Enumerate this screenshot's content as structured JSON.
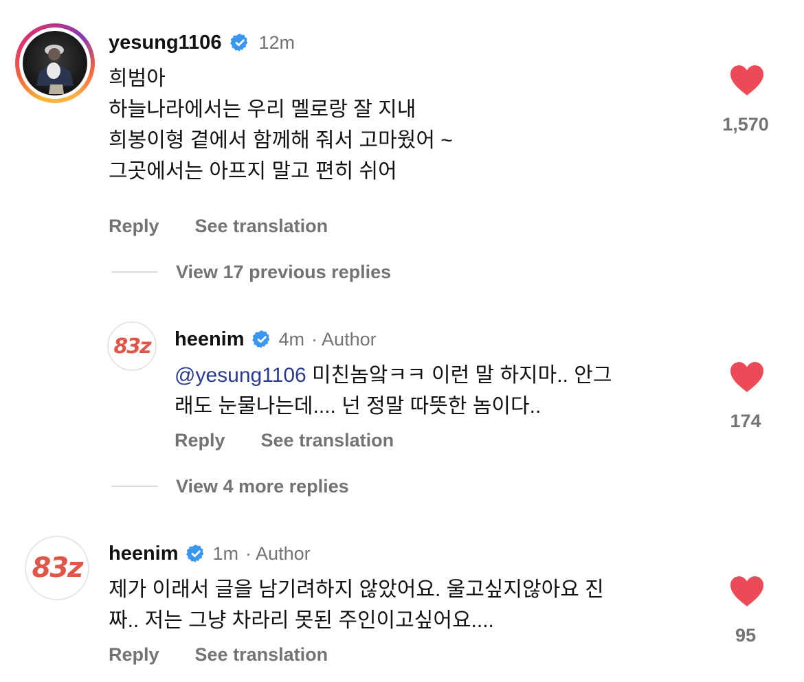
{
  "comments": [
    {
      "username": "yesung1106",
      "time": "12m",
      "lines": [
        "희범아",
        "하늘나라에서는 우리 멜로랑 잘 지내",
        "희봉이형 곁에서 함께해 줘서 고마웠어 ~",
        "그곳에서는 아프지 말고 편히 쉬어"
      ],
      "likes": "1,570",
      "reply_label": "Reply",
      "translate_label": "See translation"
    },
    {
      "username": "heenim",
      "time": "4m",
      "author_tag": "· Author",
      "mention": "@yesung1106",
      "line1_rest": " 미친놈앜ㅋㅋ 이런 말 하지마.. 안그",
      "line2": "래도 눈물나는데.... 넌 정말 따뜻한 놈이다..",
      "likes": "174",
      "reply_label": "Reply",
      "translate_label": "See translation"
    },
    {
      "username": "heenim",
      "time": "1m",
      "author_tag": "· Author",
      "lines": [
        "제가 이래서 글을 남기려하지 않았어요. 울고싶지않아요 진",
        "짜.. 저는 그냥 차라리 못된 주인이고싶어요...."
      ],
      "likes": "95",
      "reply_label": "Reply",
      "translate_label": "See translation"
    }
  ],
  "thread_controls": {
    "view_previous": "View 17 previous replies",
    "view_more": "View 4 more replies"
  },
  "logo_text": "83z",
  "colors": {
    "heart": "#ed4956",
    "verified": "#3897f0",
    "secondary_text": "#737373",
    "mention": "#2b3b8f"
  },
  "icons": [
    "verified-badge-icon",
    "heart-icon"
  ]
}
